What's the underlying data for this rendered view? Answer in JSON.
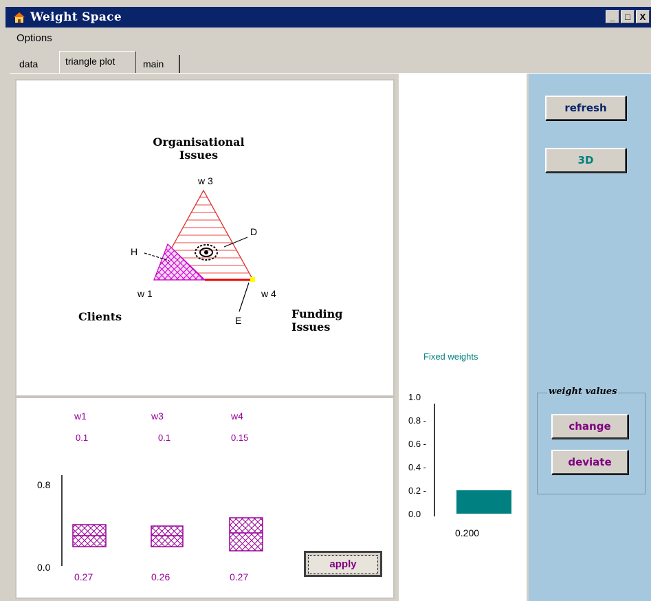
{
  "window": {
    "title": "Weight Space",
    "controls": [
      "_",
      "□",
      "X"
    ]
  },
  "menu": {
    "options": "Options"
  },
  "tabs": [
    {
      "label": "data"
    },
    {
      "label": "triangle plot",
      "active": true
    },
    {
      "label": "main"
    }
  ],
  "triangle": {
    "top_label_line1": "Organisational",
    "top_label_line2": "Issues",
    "left_label": "Clients",
    "right_label_line1": "Funding",
    "right_label_line2": "Issues",
    "vertex_top": "w 3",
    "vertex_left": "w 1",
    "vertex_right": "w 4",
    "marker_h": "H",
    "marker_d": "D",
    "marker_e": "E"
  },
  "bars": {
    "weights": [
      {
        "name": "w1",
        "value": "0.1",
        "bottom": "0.27"
      },
      {
        "name": "w3",
        "value": "0.1",
        "bottom": "0.26"
      },
      {
        "name": "w4",
        "value": "0.15",
        "bottom": "0.27"
      }
    ],
    "axis_top": "0.8",
    "axis_bottom": "0.0",
    "apply_label": "apply"
  },
  "fixed": {
    "title": "Fixed weights",
    "ticks": [
      "1.0",
      "0.8",
      "0.6",
      "0.4",
      "0.2",
      "0.0"
    ],
    "value": 0.2,
    "value_label": "0.200"
  },
  "controls": {
    "refresh_label": "refresh",
    "three_d_label": "3D",
    "group_label": "weight values",
    "change_label": "change",
    "deviate_label": "deviate"
  },
  "colors": {
    "accent_teal": "#008080",
    "purple": "#990099",
    "titlebar": "#0a246a",
    "right_panel": "#a6c8de"
  }
}
